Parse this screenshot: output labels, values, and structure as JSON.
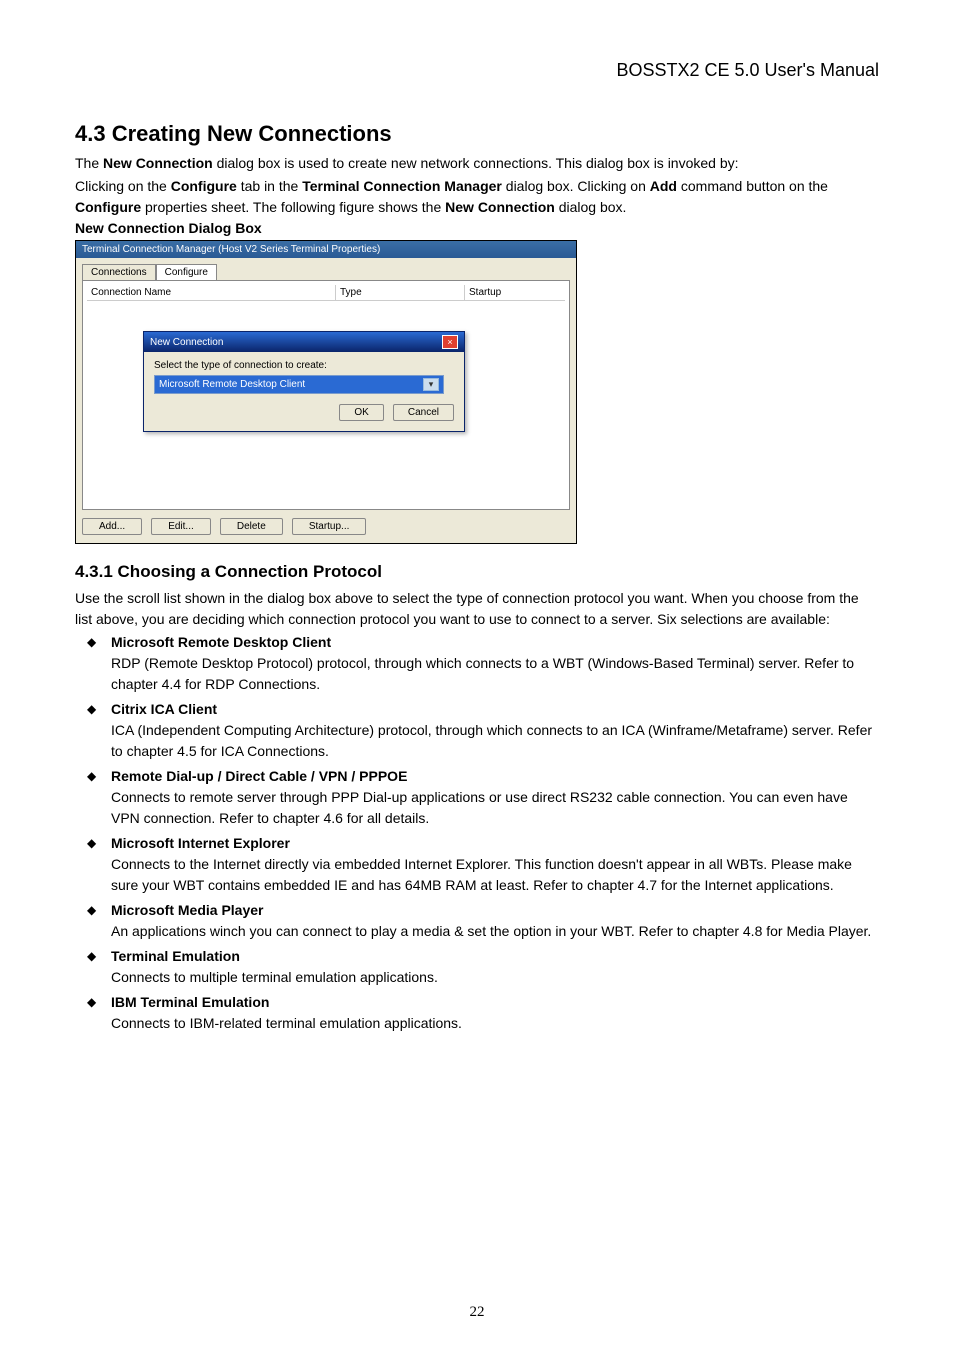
{
  "header": {
    "title": "BOSSTX2 CE 5.0 User's Manual"
  },
  "section": {
    "number_title": "4.3  Creating New Connections",
    "p1_a": "The ",
    "p1_b": "New Connection",
    "p1_c": " dialog box is used to create new network connections. This dialog box is invoked by:",
    "p2_a": "Clicking on the ",
    "p2_b": "Configure",
    "p2_c": " tab in the ",
    "p2_d": "Terminal Connection Manager",
    "p2_e": " dialog box. Clicking on ",
    "p2_f": "Add",
    "p2_g": " command button on the ",
    "p2_h": "Configure",
    "p2_i": " properties sheet. The following figure shows the ",
    "p2_j": "New Connection",
    "p2_k": " dialog box.",
    "caption": "New Connection Dialog Box"
  },
  "screenshot": {
    "window_title": "Terminal Connection Manager (Host V2 Series Terminal Properties)",
    "tab_connections": "Connections",
    "tab_configure": "Configure",
    "col_name": "Connection Name",
    "col_type": "Type",
    "col_startup": "Startup",
    "modal_title": "New Connection",
    "modal_label": "Select the type of connection to create:",
    "modal_selected": "Microsoft Remote Desktop Client",
    "ok": "OK",
    "cancel": "Cancel",
    "btn_add": "Add...",
    "btn_edit": "Edit...",
    "btn_delete": "Delete",
    "btn_startup": "Startup..."
  },
  "subsection": {
    "number_title": "4.3.1   Choosing a Connection Protocol",
    "intro": "Use the scroll list shown in the dialog box above to select the type of connection protocol you want. When you choose from the list above, you are deciding which connection protocol you want to use to connect to a server. Six selections are available:"
  },
  "protocols": [
    {
      "title": "Microsoft Remote Desktop Client",
      "desc": "RDP (Remote Desktop Protocol) protocol, through which connects to a WBT (Windows-Based Terminal) server. Refer to chapter 4.4 for RDP Connections."
    },
    {
      "title": "Citrix ICA Client",
      "desc": "ICA (Independent Computing Architecture) protocol, through which connects to an ICA (Winframe/Metaframe) server. Refer to chapter 4.5 for ICA Connections."
    },
    {
      "title": "Remote Dial-up / Direct Cable / VPN / PPPOE",
      "desc": "Connects to remote server through PPP Dial-up applications or use direct RS232 cable connection. You can even have VPN connection. Refer to chapter 4.6 for all details."
    },
    {
      "title": "Microsoft Internet Explorer",
      "desc": "Connects to the Internet directly via embedded Internet Explorer. This function doesn't appear in all WBTs. Please make sure your WBT contains embedded IE and has 64MB RAM at least. Refer to chapter 4.7 for the Internet applications."
    },
    {
      "title": "Microsoft Media Player",
      "desc": "An applications winch you can connect to play a media & set the option in your WBT. Refer to chapter 4.8 for Media Player."
    },
    {
      "title": "Terminal Emulation",
      "desc": "Connects to multiple terminal emulation applications."
    },
    {
      "title": "IBM Terminal Emulation",
      "desc": "Connects to IBM-related terminal emulation applications."
    }
  ],
  "page_number": "22"
}
